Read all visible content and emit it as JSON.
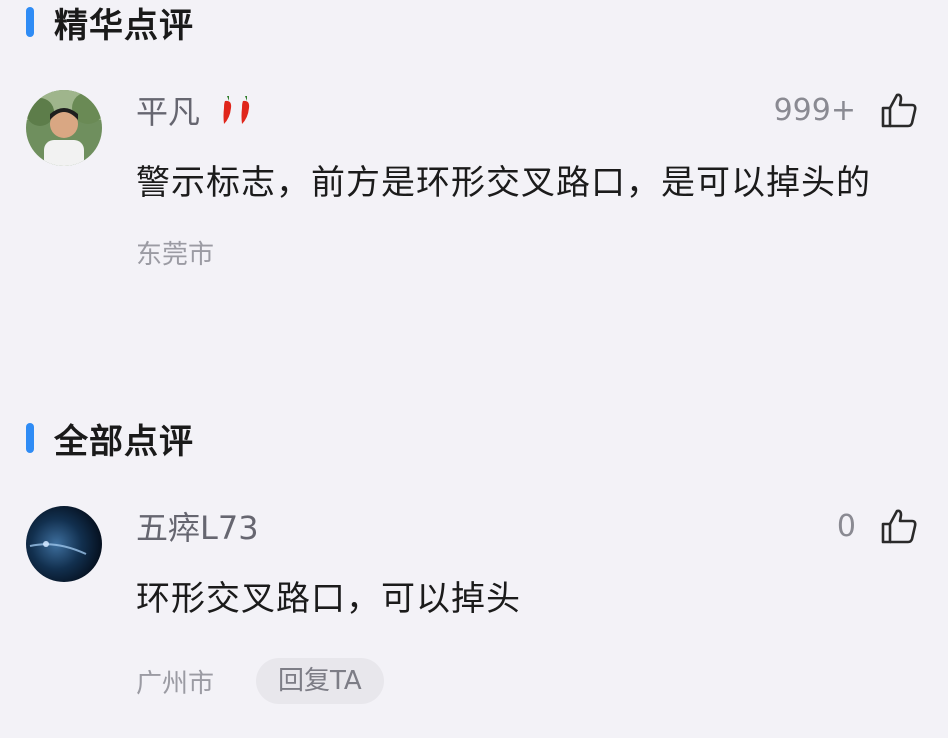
{
  "sections": {
    "featured": {
      "title": "精华点评"
    },
    "all": {
      "title": "全部点评"
    }
  },
  "colors": {
    "accent": "#2f8cf5",
    "background": "#f3f2f7",
    "pepper": "#e0261b"
  },
  "featured_comment": {
    "username": "平凡",
    "badge_icon": "chili-pepper-icon",
    "like_count": "999+",
    "text": "警示标志，前方是环形交叉路口，是可以掉头的",
    "location": "东莞市"
  },
  "all_comment": {
    "username": "五瘁L73",
    "like_count": "0",
    "text": "环形交叉路口，可以掉头",
    "location": "广州市",
    "reply_label": "回复TA"
  }
}
